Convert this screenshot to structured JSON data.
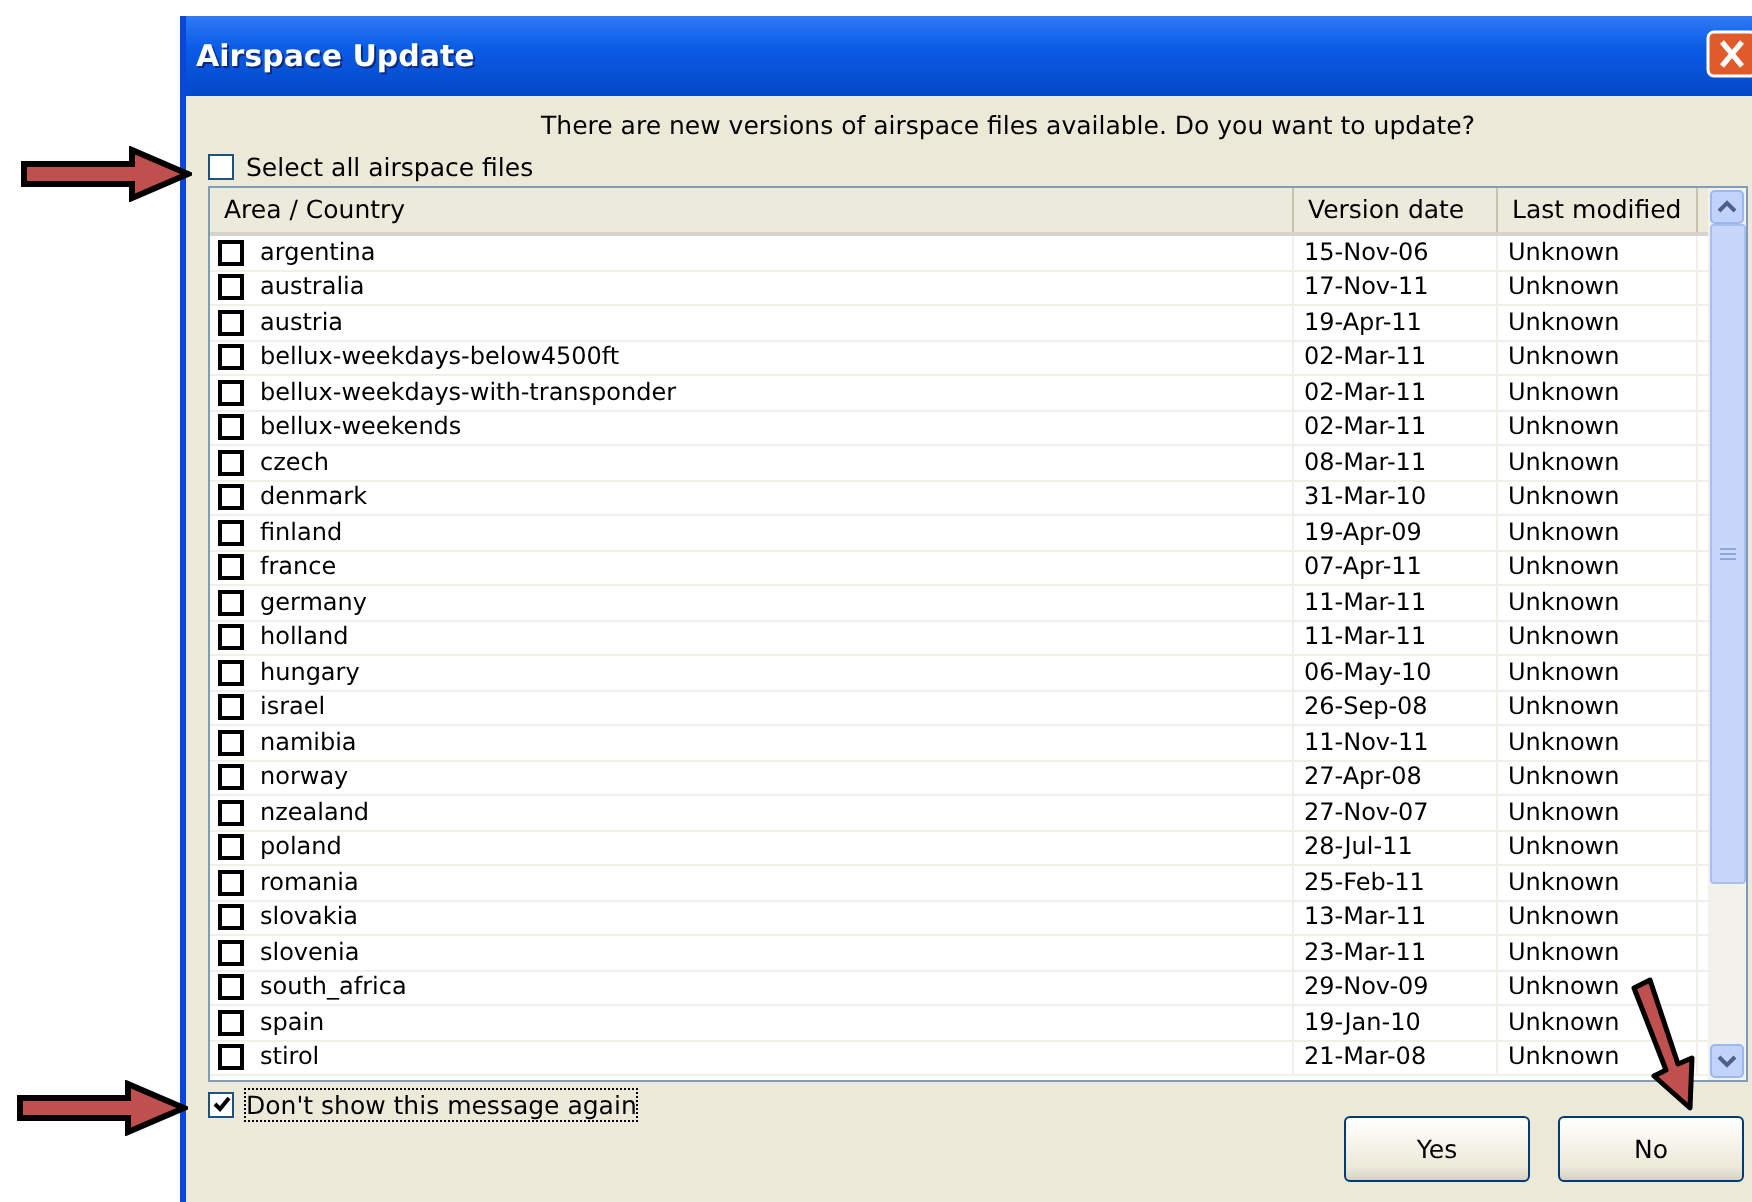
{
  "window": {
    "title": "Airspace Update"
  },
  "message": "There are new versions of airspace files available. Do you want to update?",
  "select_all": {
    "label": "Select all airspace files",
    "checked": false
  },
  "table": {
    "columns": [
      "Area / Country",
      "Version date",
      "Last modified"
    ],
    "rows": [
      {
        "name": "argentina",
        "version_date": "15-Nov-06",
        "last_modified": "Unknown",
        "checked": false
      },
      {
        "name": "australia",
        "version_date": "17-Nov-11",
        "last_modified": "Unknown",
        "checked": false
      },
      {
        "name": "austria",
        "version_date": "19-Apr-11",
        "last_modified": "Unknown",
        "checked": false
      },
      {
        "name": "bellux-weekdays-below4500ft",
        "version_date": "02-Mar-11",
        "last_modified": "Unknown",
        "checked": false
      },
      {
        "name": "bellux-weekdays-with-transponder",
        "version_date": "02-Mar-11",
        "last_modified": "Unknown",
        "checked": false
      },
      {
        "name": "bellux-weekends",
        "version_date": "02-Mar-11",
        "last_modified": "Unknown",
        "checked": false
      },
      {
        "name": "czech",
        "version_date": "08-Mar-11",
        "last_modified": "Unknown",
        "checked": false
      },
      {
        "name": "denmark",
        "version_date": "31-Mar-10",
        "last_modified": "Unknown",
        "checked": false
      },
      {
        "name": "finland",
        "version_date": "19-Apr-09",
        "last_modified": "Unknown",
        "checked": false
      },
      {
        "name": "france",
        "version_date": "07-Apr-11",
        "last_modified": "Unknown",
        "checked": false
      },
      {
        "name": "germany",
        "version_date": "11-Mar-11",
        "last_modified": "Unknown",
        "checked": false
      },
      {
        "name": "holland",
        "version_date": "11-Mar-11",
        "last_modified": "Unknown",
        "checked": false
      },
      {
        "name": "hungary",
        "version_date": "06-May-10",
        "last_modified": "Unknown",
        "checked": false
      },
      {
        "name": "israel",
        "version_date": "26-Sep-08",
        "last_modified": "Unknown",
        "checked": false
      },
      {
        "name": "namibia",
        "version_date": "11-Nov-11",
        "last_modified": "Unknown",
        "checked": false
      },
      {
        "name": "norway",
        "version_date": "27-Apr-08",
        "last_modified": "Unknown",
        "checked": false
      },
      {
        "name": "nzealand",
        "version_date": "27-Nov-07",
        "last_modified": "Unknown",
        "checked": false
      },
      {
        "name": "poland",
        "version_date": "28-Jul-11",
        "last_modified": "Unknown",
        "checked": false
      },
      {
        "name": "romania",
        "version_date": "25-Feb-11",
        "last_modified": "Unknown",
        "checked": false
      },
      {
        "name": "slovakia",
        "version_date": "13-Mar-11",
        "last_modified": "Unknown",
        "checked": false
      },
      {
        "name": "slovenia",
        "version_date": "23-Mar-11",
        "last_modified": "Unknown",
        "checked": false
      },
      {
        "name": "south_africa",
        "version_date": "29-Nov-09",
        "last_modified": "Unknown",
        "checked": false
      },
      {
        "name": "spain",
        "version_date": "19-Jan-10",
        "last_modified": "Unknown",
        "checked": false
      },
      {
        "name": "stirol",
        "version_date": "21-Mar-08",
        "last_modified": "Unknown",
        "checked": false
      }
    ]
  },
  "dont_show": {
    "label": "Don't show this message again",
    "checked": true
  },
  "buttons": [
    "Yes",
    "No"
  ]
}
